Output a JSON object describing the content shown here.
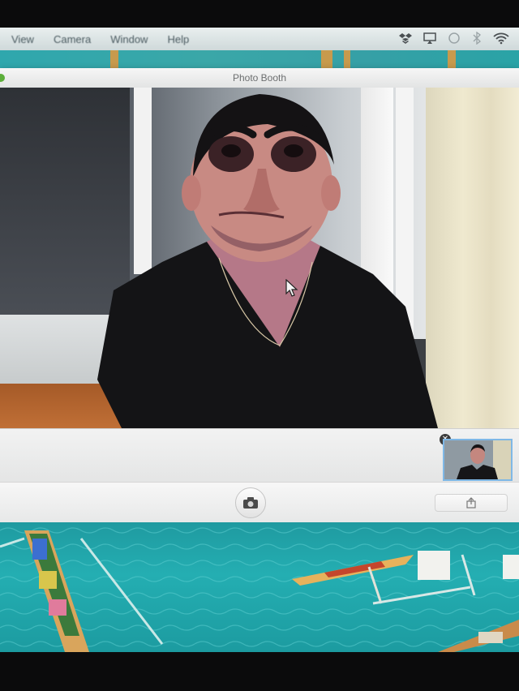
{
  "menubar": {
    "items": [
      "View",
      "Camera",
      "Window",
      "Help"
    ]
  },
  "window": {
    "title": "Photo Booth"
  },
  "colors": {
    "desktop": "#24aeb2",
    "accent": "#7fb8e6"
  },
  "icons": {
    "status": [
      "dropbox-icon",
      "airplay-icon",
      "sync-icon",
      "bluetooth-icon",
      "wifi-icon"
    ],
    "take_photo": "camera-icon",
    "share": "share-icon",
    "thumbnail_close": "close-icon"
  }
}
